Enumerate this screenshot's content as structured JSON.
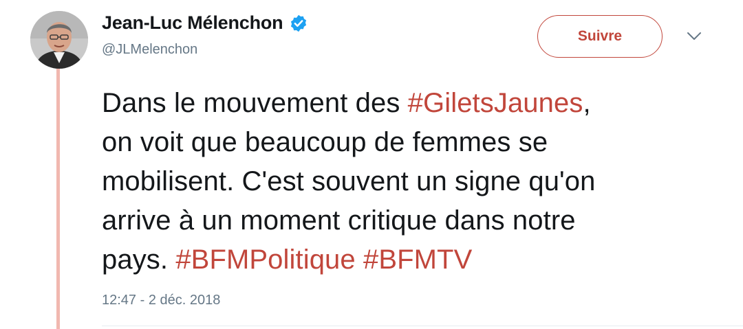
{
  "user": {
    "name": "Jean-Luc Mélenchon",
    "handle": "@JLMelenchon",
    "verified": true
  },
  "follow_button": {
    "label": "Suivre"
  },
  "tweet": {
    "lines": [
      [
        {
          "text": "Dans le mouvement des "
        },
        {
          "text": "#GiletsJaunes",
          "hashtag": true
        },
        {
          "text": ","
        }
      ],
      [
        {
          "text": "on voit que beaucoup de femmes se"
        }
      ],
      [
        {
          "text": "mobilisent. C'est souvent un signe qu'on"
        }
      ],
      [
        {
          "text": "arrive à un moment critique dans notre"
        }
      ],
      [
        {
          "text": "pays. "
        },
        {
          "text": "#BFMPolitique",
          "hashtag": true
        },
        {
          "text": " "
        },
        {
          "text": "#BFMTV",
          "hashtag": true
        }
      ]
    ],
    "timestamp": "12:47 - 2 déc. 2018"
  },
  "colors": {
    "accent": "#c1463b",
    "verified_badge": "#1da1f2",
    "thread_line": "#f1b8b0",
    "secondary_text": "#657786",
    "primary_text": "#14171a"
  },
  "icons": {
    "verified": "verified-badge-icon",
    "more": "chevron-down-icon",
    "avatar": "profile-photo"
  }
}
